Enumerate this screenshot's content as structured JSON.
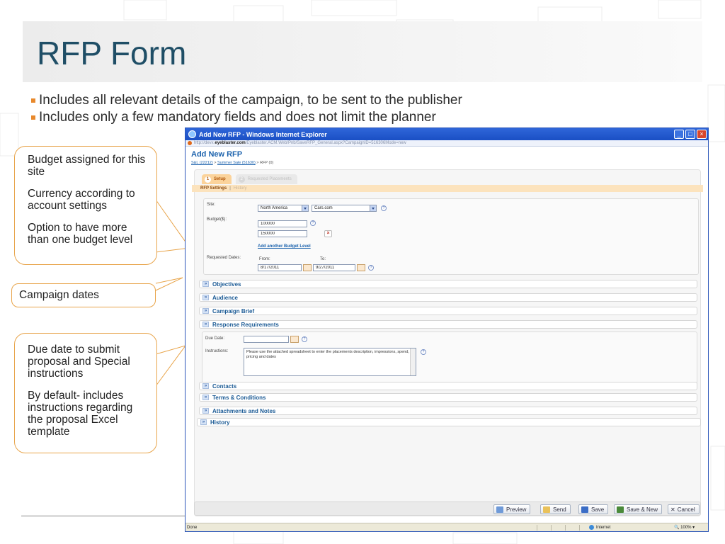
{
  "slide": {
    "title": "RFP Form",
    "bullets": [
      "Includes all relevant details of the campaign, to be sent to the publisher",
      "Includes only a few mandatory fields and does not limit the planner"
    ]
  },
  "callouts": {
    "budget": [
      "Budget assigned for this site",
      "Currency according to account settings",
      "Option to have more than one budget level"
    ],
    "dates": "Campaign dates",
    "due": [
      "Due date to submit proposal and Special instructions",
      "By default- includes instructions regarding the proposal Excel template"
    ]
  },
  "window": {
    "title": "Add New RFP - Windows Internet Explorer",
    "url_prefix": "http://devx.",
    "url_host": "eyeblaster.com",
    "url_rest": "/Eyeblaster.ACM.Web/Pnb/SaveRFP_General.aspx?CampaignID=516306Mode=new",
    "status_text": "Done",
    "zone": "Internet",
    "zoom": "100%"
  },
  "page": {
    "title": "Add New RFP",
    "breadcrumb": [
      "S&L (22212)",
      "Summer Sale (51630)",
      "RFP (0)"
    ],
    "steps": [
      {
        "num": "1",
        "label": "Setup"
      },
      {
        "num": "2",
        "label": "Requested Placements"
      }
    ],
    "subtabs": [
      "RFP Settings",
      "History"
    ]
  },
  "form": {
    "site_label": "Site:",
    "region": "North America",
    "site": "Cars.com",
    "budget_label": "Budget($):",
    "budgets": [
      "100000",
      "150000"
    ],
    "add_budget": "Add another Budget Level",
    "dates_label": "Requested Dates:",
    "from_label": "From:",
    "to_label": "To:",
    "from": "8/17/2011",
    "to": "9/27/2011",
    "help": "?",
    "remove": "×"
  },
  "sections": [
    "Objectives",
    "Audience",
    "Campaign Brief",
    "Response Requirements",
    "Contacts",
    "Terms & Conditions",
    "Attachments and Notes",
    "History"
  ],
  "response": {
    "due_label": "Due Date:",
    "instr_label": "Instructions:",
    "instructions": "Please use the attached spreadsheet to enter the placements description, impressions, spend, pricing and dates"
  },
  "actions": [
    "Preview",
    "Send",
    "Save",
    "Save & New",
    "Cancel"
  ],
  "colors": {
    "accent": "#e8892c",
    "title": "#1f4e66",
    "link": "#1d63ad",
    "callout_border": "#e8a44a"
  }
}
